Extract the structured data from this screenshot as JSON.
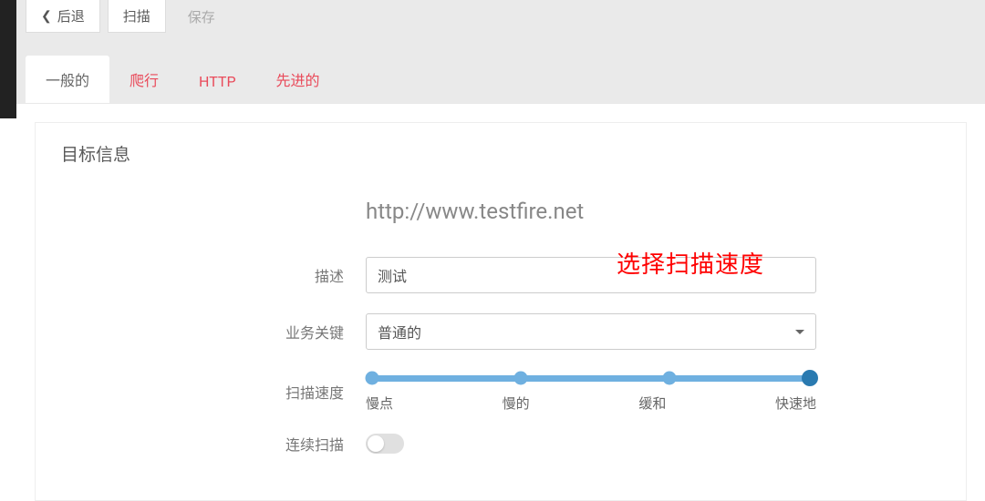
{
  "toolbar": {
    "back_label": "后退",
    "scan_label": "扫描",
    "save_label": "保存"
  },
  "tabs": {
    "general": "一般的",
    "crawl": "爬行",
    "http": "HTTP",
    "advanced": "先进的"
  },
  "card": {
    "title": "目标信息",
    "url": "http://www.testfire.net"
  },
  "annotation": "选择扫描速度",
  "form": {
    "description_label": "描述",
    "description_value": "测试",
    "criticality_label": "业务关键",
    "criticality_value": "普通的",
    "scan_speed_label": "扫描速度",
    "slider_labels": {
      "slowest": "慢点",
      "slow": "慢的",
      "moderate": "缓和",
      "fast": "快速地"
    },
    "continuous_scan_label": "连续扫描",
    "continuous_scan_value": false
  }
}
